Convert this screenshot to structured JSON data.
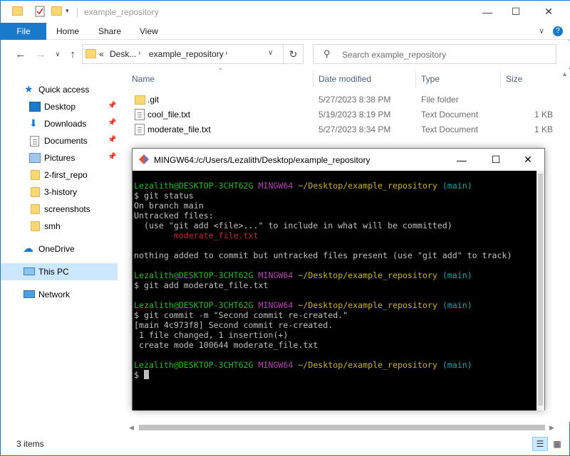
{
  "explorer": {
    "title": "example_repository",
    "ribbon": {
      "file": "File",
      "home": "Home",
      "share": "Share",
      "view": "View"
    },
    "address": {
      "prefix": "«",
      "crumb1": "Desk...",
      "crumb2": "example_repository"
    },
    "search_placeholder": "Search example_repository",
    "sidebar": {
      "quick_access": "Quick access",
      "items": [
        {
          "label": "Desktop",
          "pinned": true
        },
        {
          "label": "Downloads",
          "pinned": true
        },
        {
          "label": "Documents",
          "pinned": true
        },
        {
          "label": "Pictures",
          "pinned": true
        },
        {
          "label": "2-first_repo",
          "pinned": false
        },
        {
          "label": "3-history",
          "pinned": false
        },
        {
          "label": "screenshots",
          "pinned": false
        },
        {
          "label": "smh",
          "pinned": false
        }
      ],
      "onedrive": "OneDrive",
      "this_pc": "This PC",
      "network": "Network"
    },
    "columns": {
      "name": "Name",
      "date": "Date modified",
      "type": "Type",
      "size": "Size"
    },
    "files": [
      {
        "name": ".git",
        "date": "5/27/2023 8:38 PM",
        "type": "File folder",
        "size": "",
        "icon": "folder-icon"
      },
      {
        "name": "cool_file.txt",
        "date": "5/19/2023 8:19 PM",
        "type": "Text Document",
        "size": "1 KB",
        "icon": "text-file-icon"
      },
      {
        "name": "moderate_file.txt",
        "date": "5/27/2023 8:34 PM",
        "type": "Text Document",
        "size": "1 KB",
        "icon": "text-file-icon"
      }
    ],
    "status": "3 items"
  },
  "terminal": {
    "title": "MINGW64:/c/Users/Lezalith/Desktop/example_repository",
    "prompt": {
      "user": "Lezalith@DESKTOP-3CHT62G",
      "env": "MINGW64",
      "path": "~/Desktop/example_repository",
      "branch": "(main)"
    },
    "lines": {
      "cmd1": "$ git status",
      "out1": "On branch main",
      "out2": "Untracked files:",
      "out3": "  (use \"git add <file>...\" to include in what will be committed)",
      "out4": "        moderate_file.txt",
      "out5": "nothing added to commit but untracked files present (use \"git add\" to track)",
      "cmd2": "$ git add moderate_file.txt",
      "cmd3": "$ git commit -m \"Second commit re-created.\"",
      "out6": "[main 4c973f8] Second commit re-created.",
      "out7": " 1 file changed, 1 insertion(+)",
      "out8": " create mode 100644 moderate_file.txt",
      "cmd4": "$ "
    }
  },
  "colors": {
    "accent": "#1979ca",
    "selected": "#cce8ff",
    "term_green": "#27bb27",
    "term_magenta": "#b545b5",
    "term_yellow": "#c9b227",
    "term_cyan": "#1aa7a7",
    "term_red": "#c22a2a"
  }
}
